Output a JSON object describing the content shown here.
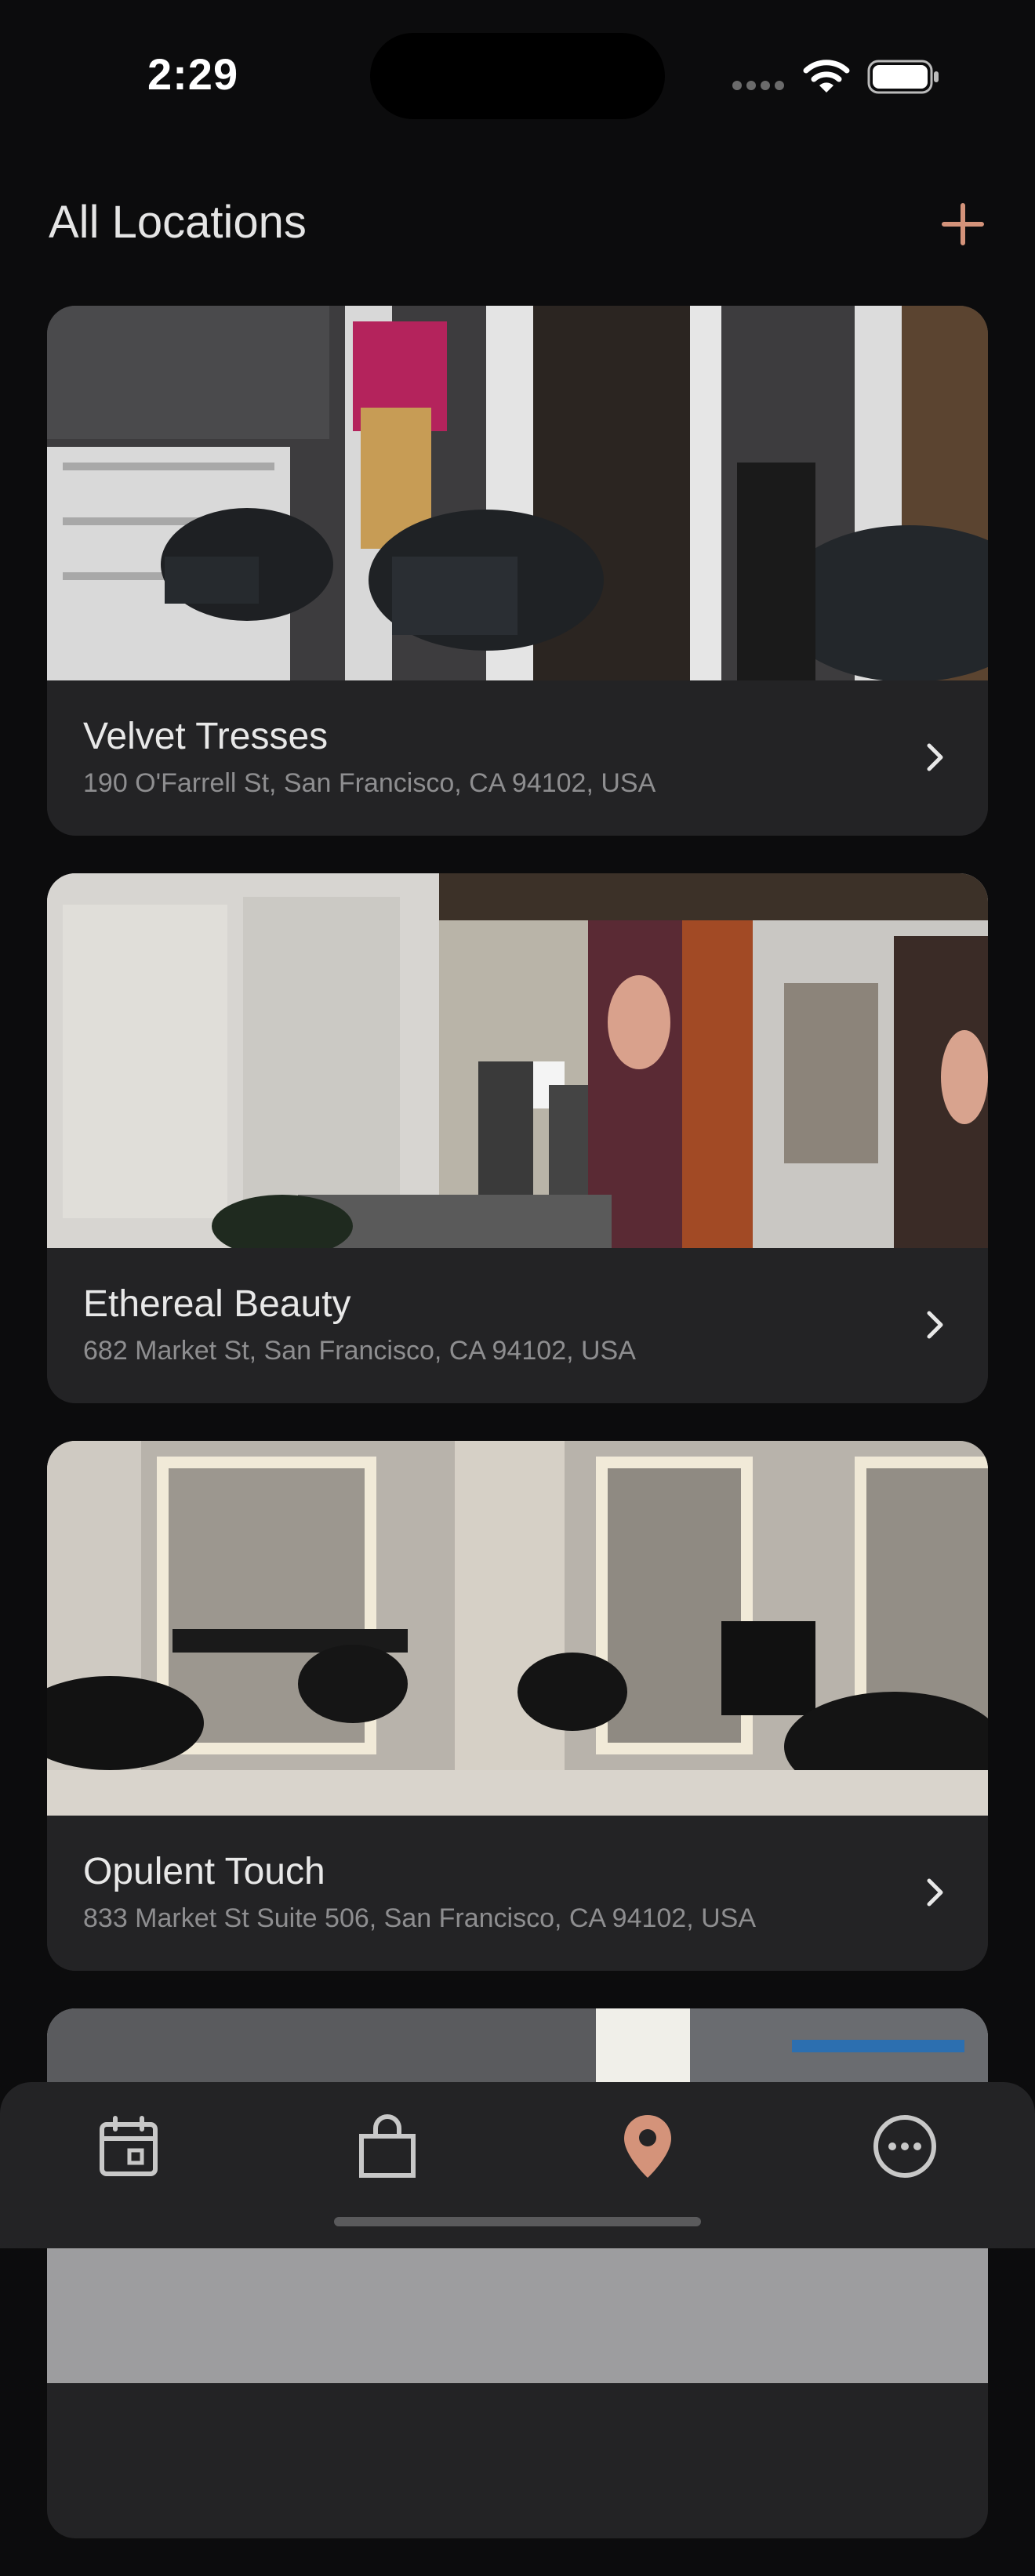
{
  "status_bar": {
    "time": "2:29"
  },
  "header": {
    "title": "All Locations",
    "add_icon": "plus-icon"
  },
  "colors": {
    "accent": "#d4937a",
    "background": "#0c0c0d",
    "card": "#232325",
    "secondary_text": "#8e8e90"
  },
  "locations": [
    {
      "name": "Velvet Tresses",
      "address": "190 O'Farrell St, San Francisco, CA 94102, USA",
      "photo": "salon-photo"
    },
    {
      "name": "Ethereal Beauty",
      "address": "682 Market St, San Francisco, CA 94102, USA",
      "photo": "salon-photo"
    },
    {
      "name": "Opulent Touch",
      "address": "833 Market St Suite 506, San Francisco, CA 94102, USA",
      "photo": "salon-photo"
    }
  ],
  "tab_bar": {
    "tabs": [
      {
        "icon": "calendar-icon",
        "active": false
      },
      {
        "icon": "shopping-bag-icon",
        "active": false
      },
      {
        "icon": "location-pin-icon",
        "active": true
      },
      {
        "icon": "more-icon",
        "active": false
      }
    ]
  }
}
